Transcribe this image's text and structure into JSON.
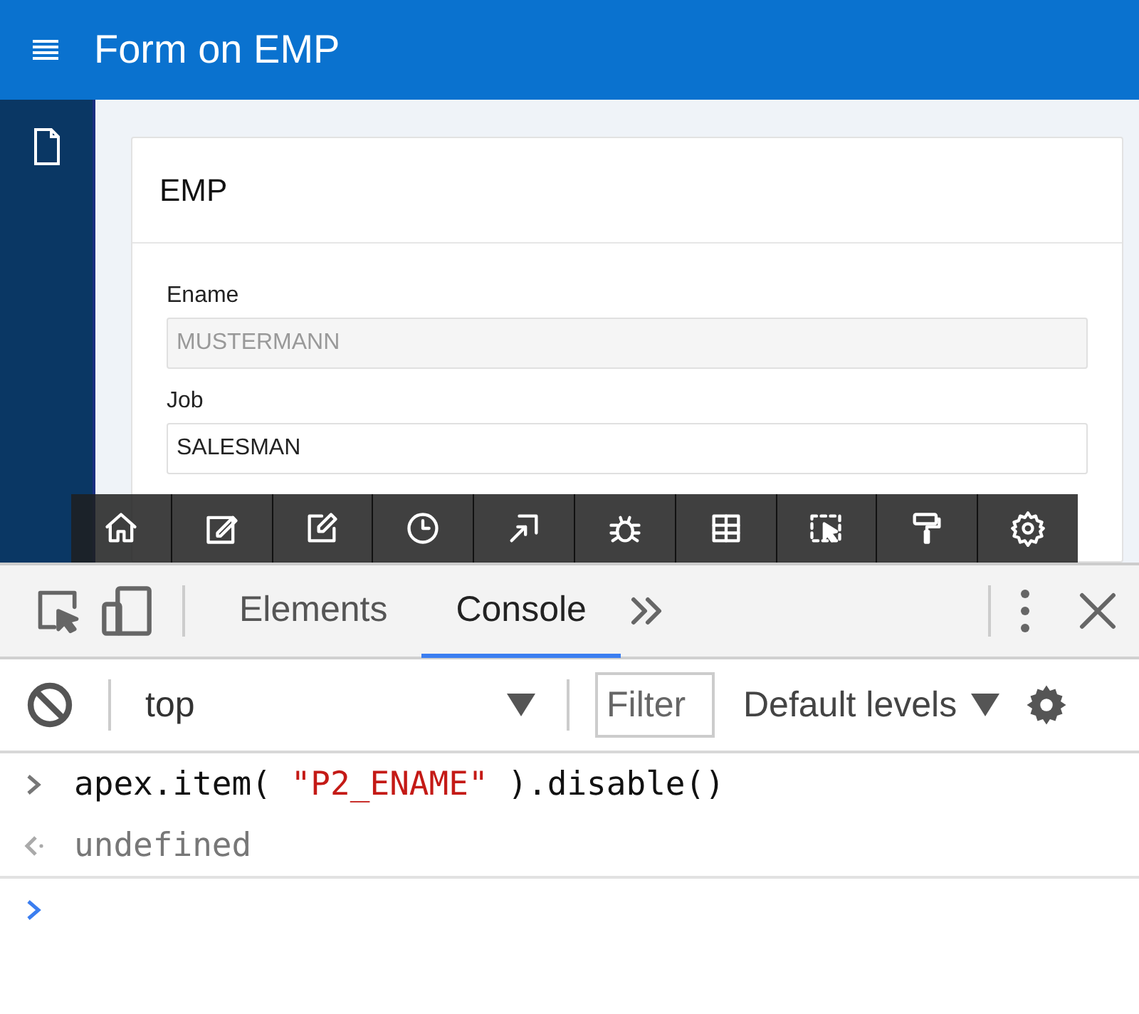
{
  "header": {
    "title": "Form on EMP"
  },
  "region": {
    "title": "EMP",
    "fields": [
      {
        "label": "Ename",
        "value": "MUSTERMANN",
        "disabled": true
      },
      {
        "label": "Job",
        "value": "SALESMAN",
        "disabled": false
      }
    ]
  },
  "devtools": {
    "tabs": [
      {
        "label": "Elements",
        "selected": false
      },
      {
        "label": "Console",
        "selected": true
      }
    ],
    "context": "top",
    "filter": {
      "placeholder": "Filter"
    },
    "levels": "Default levels",
    "console": [
      {
        "kind": "input",
        "parts": [
          {
            "kind": "code",
            "text": "apex.item( "
          },
          {
            "kind": "string",
            "text": "\"P2_ENAME\""
          },
          {
            "kind": "code",
            "text": " ).disable()"
          }
        ]
      },
      {
        "kind": "result",
        "parts": [
          {
            "kind": "code",
            "text": "undefined"
          }
        ]
      }
    ]
  }
}
